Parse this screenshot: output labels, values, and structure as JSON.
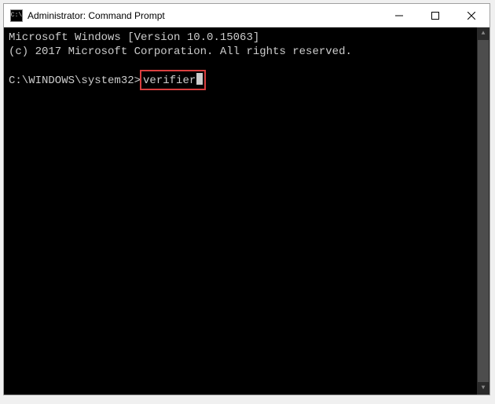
{
  "window": {
    "title": "Administrator: Command Prompt",
    "icon_glyph": "C:\\"
  },
  "terminal": {
    "line1": "Microsoft Windows [Version 10.0.15063]",
    "line2": "(c) 2017 Microsoft Corporation. All rights reserved.",
    "prompt": "C:\\WINDOWS\\system32>",
    "command": "verifier"
  }
}
